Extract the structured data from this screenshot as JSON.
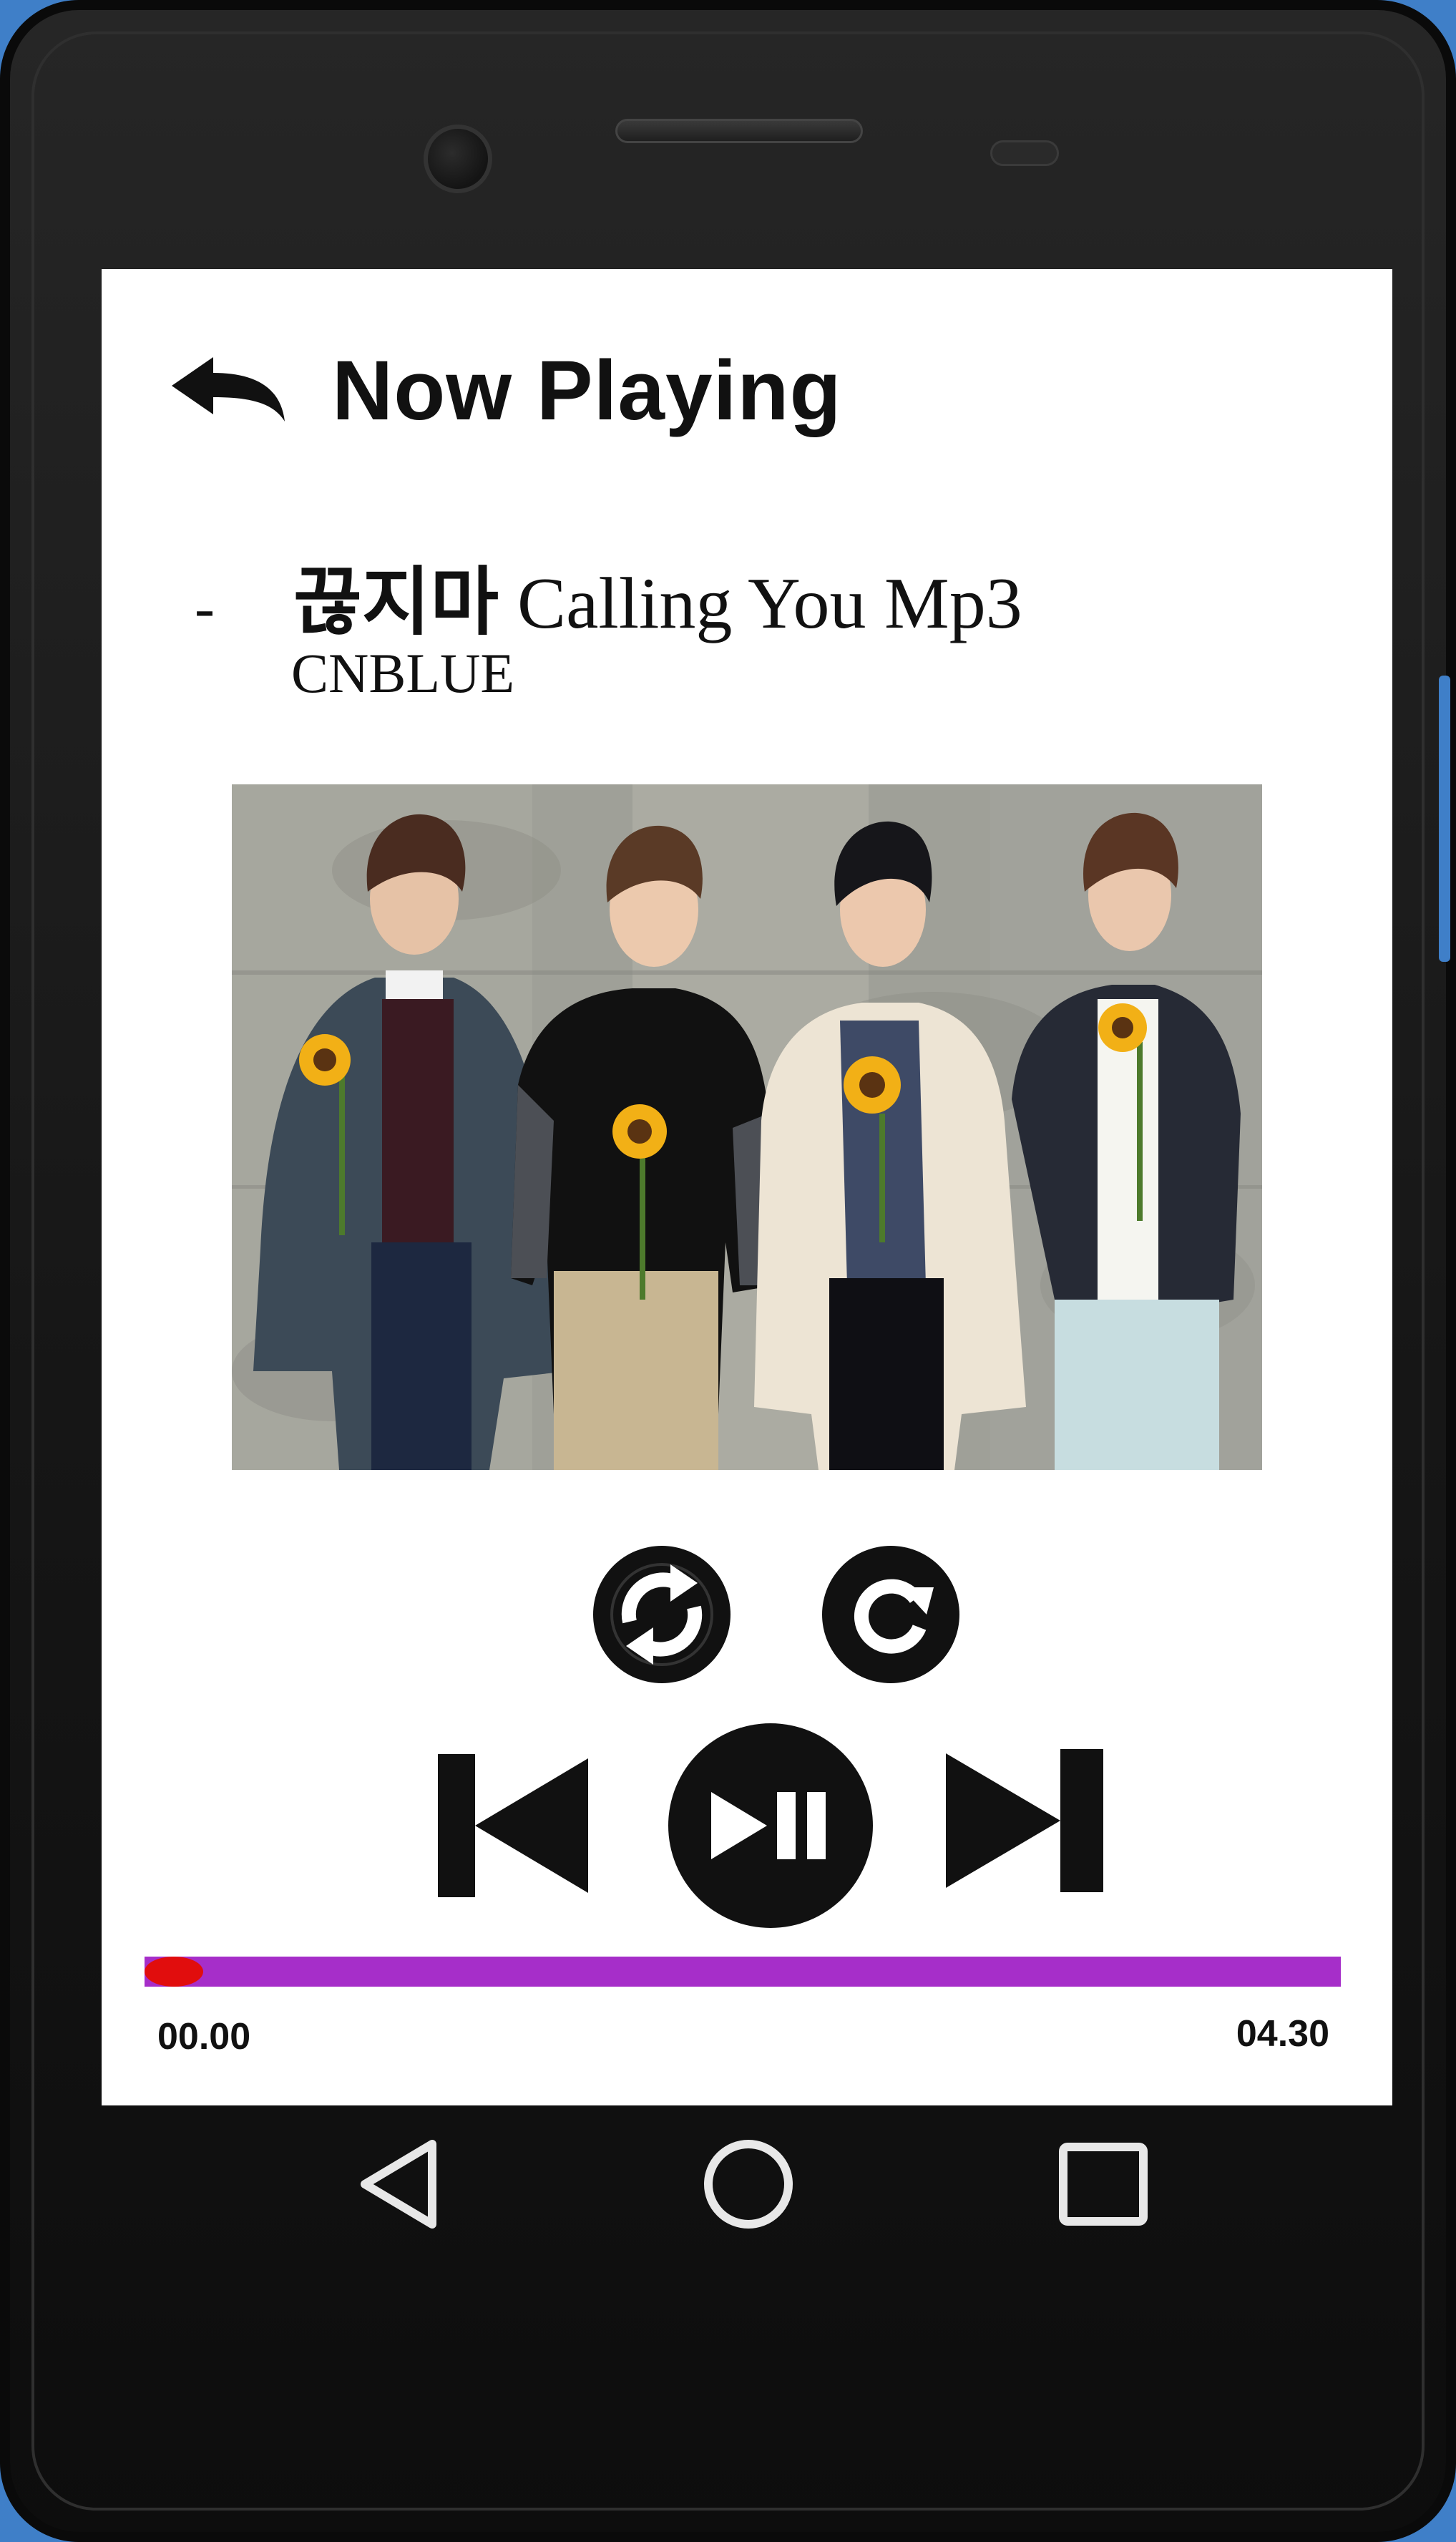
{
  "app": {
    "title": "Now Playing"
  },
  "track": {
    "bullet": "-",
    "title_korean": "끊지마",
    "title_english": "Calling You Mp3",
    "artist": "CNBLUE"
  },
  "player": {
    "position_label": "00.00",
    "duration_label": "04.30",
    "progress_fraction": 0.0
  },
  "icons": {
    "back": "back-arrow-icon",
    "shuffle": "shuffle-icon",
    "repeat": "repeat-icon",
    "previous": "skip-previous-icon",
    "play_pause": "play-pause-icon",
    "next": "skip-next-icon",
    "nav_back": "nav-back-icon",
    "nav_home": "nav-home-icon",
    "nav_recents": "nav-recents-icon"
  },
  "colors": {
    "progress_track": "#a62ec9",
    "progress_thumb": "#e10d0d",
    "device_frame": "#1a1a1a",
    "device_accent": "#3f7fc8"
  }
}
